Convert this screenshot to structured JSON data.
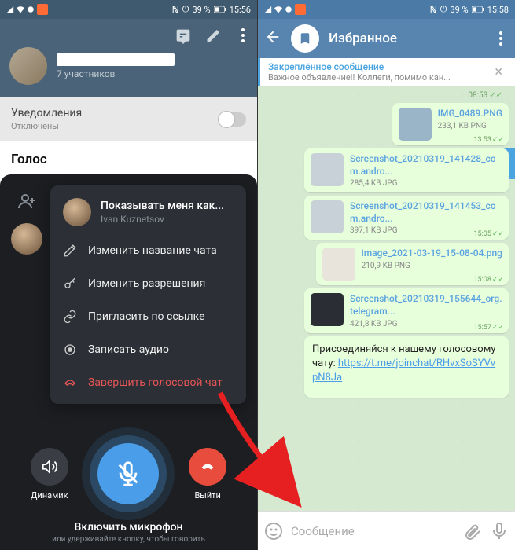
{
  "phone1": {
    "status": {
      "battery": "39 %",
      "time": "15:56"
    },
    "group": {
      "subtitle": "7 участников"
    },
    "notif": {
      "title": "Уведомления",
      "sub": "Отключены"
    },
    "voice_title": "Голос",
    "menu": {
      "header_title": "Показывать меня как...",
      "header_sub": "Ivan Kuznetsov",
      "items": [
        "Изменить название чата",
        "Изменить разрешения",
        "Пригласить по ссылке",
        "Записать аудио",
        "Завершить голосовой чат"
      ]
    },
    "controls": {
      "speaker": "Динамик",
      "leave": "Выйти"
    },
    "hint": {
      "title": "Включить микрофон",
      "sub": "или удерживайте кнопку, чтобы говорить"
    }
  },
  "phone2": {
    "status": {
      "battery": "39 %",
      "time": "15:58"
    },
    "title": "Избранное",
    "pinned": {
      "title": "Закреплённое сообщение",
      "sub": "Важное объявление!! Коллеги, помимо кан..."
    },
    "messages": [
      {
        "time_solo": "08:53"
      },
      {
        "fname": "IMG_0489.PNG",
        "meta": "233,1 KB PNG",
        "time": "13:53",
        "doc": true
      },
      {
        "fname": "Screenshot_20210319_141428_com.andro...",
        "meta": "285,4 KB JPG",
        "time": ""
      },
      {
        "fname": "Screenshot_20210319_141453_com.andro...",
        "meta": "397,1 KB JPG",
        "time": "15:05"
      },
      {
        "fname": "image_2021-03-19_15-08-04.png",
        "meta": "210,9 KB PNG",
        "time": "15:08"
      },
      {
        "fname": "Screenshot_20210319_155644_org.telegram...",
        "meta": "421,8 KB JPG",
        "time": "15:57",
        "dark": true
      }
    ],
    "text_msg": {
      "before": "Присоединяйся к нашему голосовому чату: ",
      "link": "https://t.me/joinchat/RHvxSoSYVvpN8Ja"
    },
    "input_placeholder": "Сообщение"
  }
}
